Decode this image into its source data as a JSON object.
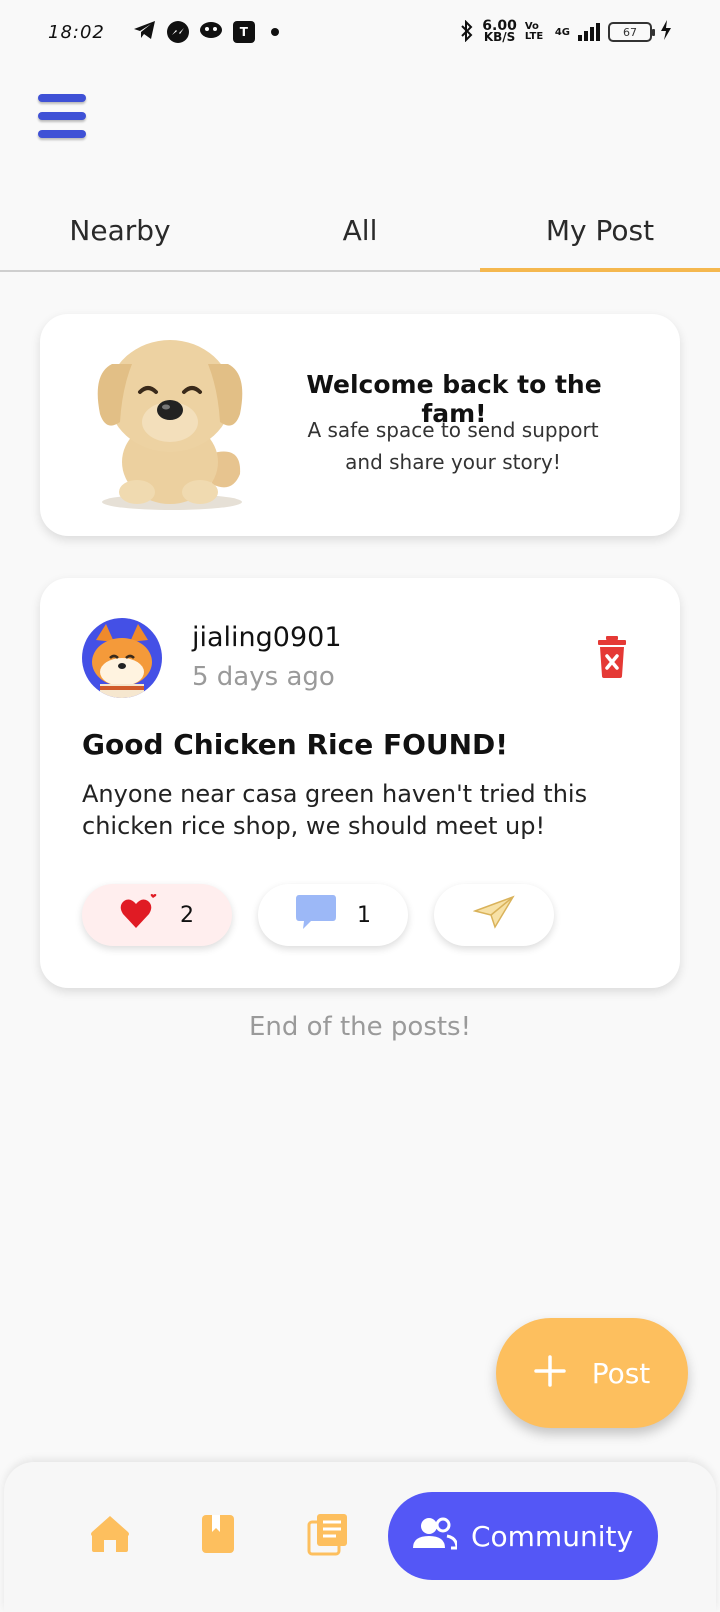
{
  "status_bar": {
    "time": "18:02",
    "net_speed_value": "6.00",
    "net_speed_unit": "KB/S",
    "volte": "Vo LTE",
    "network": "4G",
    "battery": "67"
  },
  "tabs": [
    {
      "label": "Nearby"
    },
    {
      "label": "All"
    },
    {
      "label": "My Post"
    }
  ],
  "welcome": {
    "title": "Welcome back to the fam!",
    "subtitle": "A safe space to send support and share your story!"
  },
  "post": {
    "username": "jialing0901",
    "time_ago": "5 days ago",
    "title": "Good Chicken Rice FOUND!",
    "body": "Anyone near casa green haven't tried this chicken rice shop, we should meet up!",
    "likes": "2",
    "comments": "1"
  },
  "feed": {
    "end_text": "End of the posts!"
  },
  "fab": {
    "label": "Post"
  },
  "bottom_nav": {
    "community_label": "Community"
  },
  "colors": {
    "accent": "#fdbf5e",
    "primary": "#5457f6",
    "menu": "#3f51d6",
    "delete": "#e53935"
  }
}
